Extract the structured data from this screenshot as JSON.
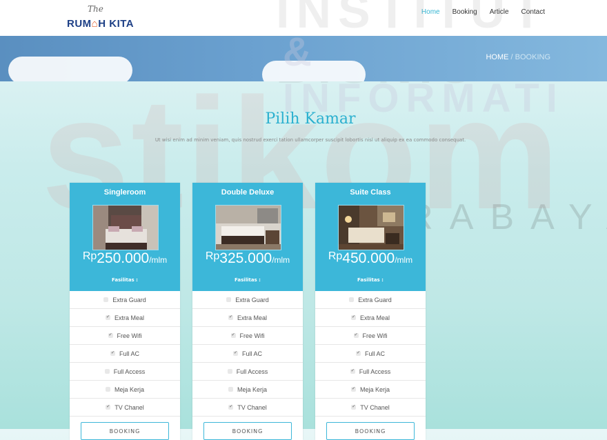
{
  "header": {
    "logo_the": "The",
    "logo_part1": "RUM",
    "logo_house": "⌂",
    "logo_part2": "H KITA",
    "nav": [
      "Home",
      "Booking",
      "Article",
      "Contact"
    ]
  },
  "banner": {
    "home": "HOME",
    "sep": " / ",
    "current": "BOOKING"
  },
  "watermark": {
    "institut": "INSTITUT BISNIS",
    "informatika": "& INFORMATI",
    "stikom": "stikom",
    "surabaya": "SURABAYA"
  },
  "section": {
    "title": "Pilih Kamar",
    "subtitle": "Ut wisi enim ad minim veniam, quis nostrud exerci tation ullamcorper suscipit lobortis nisl ut aliquip ex ea commodo consequat."
  },
  "cards": [
    {
      "name": "Singleroom",
      "currency": "Rp",
      "price": "250.000",
      "unit": "/mlm",
      "fasilitas": "Fasilitas :",
      "features": [
        {
          "label": "Extra Guard",
          "checked": false
        },
        {
          "label": "Extra Meal",
          "checked": true
        },
        {
          "label": "Free Wifi",
          "checked": true
        },
        {
          "label": "Full AC",
          "checked": true
        },
        {
          "label": "Full Access",
          "checked": false
        },
        {
          "label": "Meja Kerja",
          "checked": false
        },
        {
          "label": "TV Chanel",
          "checked": true
        }
      ],
      "button": "BOOKING"
    },
    {
      "name": "Double Deluxe",
      "currency": "Rp",
      "price": "325.000",
      "unit": "/mlm",
      "fasilitas": "Fasilitas :",
      "features": [
        {
          "label": "Extra Guard",
          "checked": false
        },
        {
          "label": "Extra Meal",
          "checked": true
        },
        {
          "label": "Free Wifi",
          "checked": true
        },
        {
          "label": "Full AC",
          "checked": true
        },
        {
          "label": "Full Access",
          "checked": false
        },
        {
          "label": "Meja Kerja",
          "checked": false
        },
        {
          "label": "TV Chanel",
          "checked": true
        }
      ],
      "button": "BOOKING"
    },
    {
      "name": "Suite Class",
      "currency": "Rp",
      "price": "450.000",
      "unit": "/mlm",
      "fasilitas": "Fasilitas :",
      "features": [
        {
          "label": "Extra Guard",
          "checked": false
        },
        {
          "label": "Extra Meal",
          "checked": true
        },
        {
          "label": "Free Wifi",
          "checked": true
        },
        {
          "label": "Full AC",
          "checked": true
        },
        {
          "label": "Full Access",
          "checked": true
        },
        {
          "label": "Meja Kerja",
          "checked": true
        },
        {
          "label": "TV Chanel",
          "checked": true
        }
      ],
      "button": "BOOKING"
    }
  ],
  "colors": {
    "accent": "#3cb7d9",
    "nav_active": "#35b5d2",
    "logo_blue": "#1d3f86",
    "logo_orange": "#e25b2a"
  }
}
